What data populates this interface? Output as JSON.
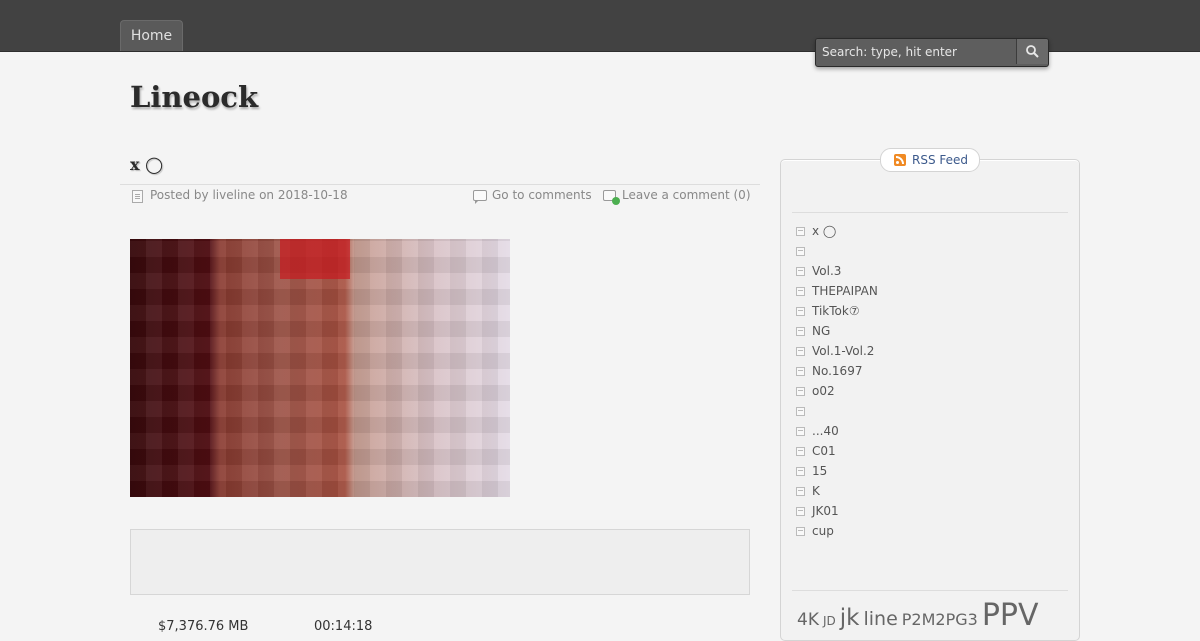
{
  "nav": {
    "home_label": "Home"
  },
  "search": {
    "placeholder": "Search: type, hit enter"
  },
  "site": {
    "title": "Lineock"
  },
  "post": {
    "title": "x ◯",
    "posted_prefix": "Posted by liveline on 2018-10-18",
    "goto_comments": "Go to comments",
    "leave_comment": "Leave a comment (0)",
    "file_size": "$7,376.76 MB",
    "duration": "00:14:18"
  },
  "sidebar": {
    "rss_label": "RSS Feed",
    "recent_posts": [
      "x ◯",
      "",
      "Vol.3",
      "THEPAIPAN",
      "TikTok⑦",
      "NG",
      " Vol.1-Vol.2",
      " No.1697",
      "o02",
      "",
      "...40",
      "C01",
      "15",
      "K",
      "JK01",
      "cup"
    ],
    "tags": [
      "4K",
      "JD",
      "jk",
      "line",
      "P2M2PG3",
      "PPV"
    ]
  },
  "colors": {
    "topbar": "#424242",
    "rss": "#f08a24",
    "background": "#f4f4f4"
  }
}
